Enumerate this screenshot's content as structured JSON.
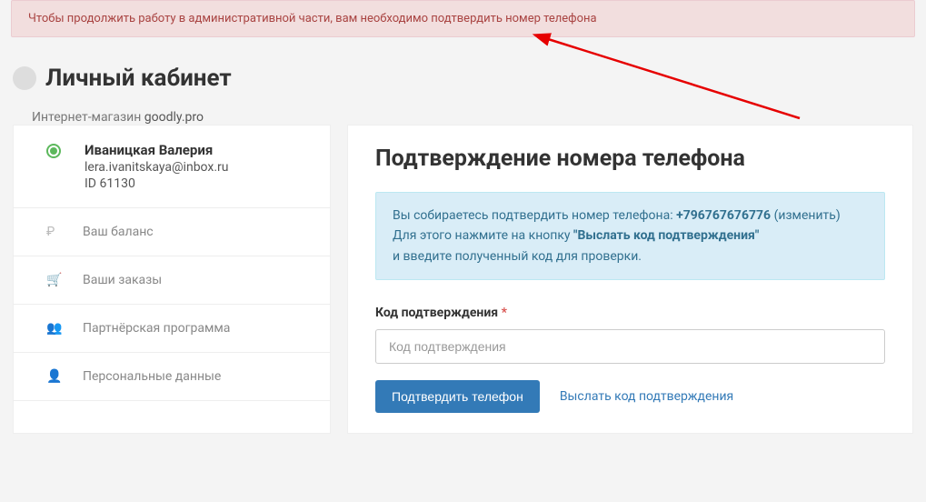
{
  "alert": {
    "message": "Чтобы продолжить работу в административной части, вам необходимо подтвердить номер телефона"
  },
  "header": {
    "title": "Личный кабинет",
    "subtitle_prefix": "Интернет-магазин ",
    "store_name": "goodly.pro"
  },
  "user": {
    "name": "Иваницкая Валерия",
    "email": "lera.ivanitskaya@inbox.ru",
    "id_label": "ID 61130"
  },
  "sidebar": {
    "items": [
      {
        "icon": "₽",
        "label": "Ваш баланс"
      },
      {
        "icon": "🛒",
        "label": "Ваши заказы"
      },
      {
        "icon": "👥",
        "label": "Партнёрская программа"
      },
      {
        "icon": "👤",
        "label": "Персональные данные"
      }
    ]
  },
  "main": {
    "title": "Подтверждение номера телефона",
    "info": {
      "line1_prefix": "Вы собираетесь подтвердить номер телефона: ",
      "phone": "+796767676776",
      "change_label": "(изменить)",
      "line2_prefix": "Для этого нажмите на кнопку ",
      "line2_bold": "\"Выслать код подтверждения\"",
      "line3": "и введите полученный код для проверки."
    },
    "form": {
      "label": "Код подтверждения",
      "required_mark": "*",
      "placeholder": "Код подтверждения",
      "submit_label": "Подтвердить телефон",
      "resend_label": "Выслать код подтверждения"
    }
  }
}
